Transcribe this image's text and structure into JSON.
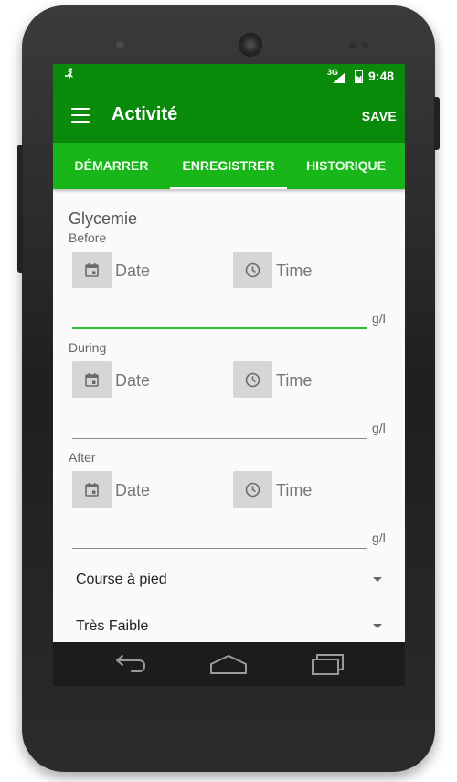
{
  "status_bar": {
    "network": "3G",
    "time": "9:48"
  },
  "app_bar": {
    "title": "Activité",
    "save_label": "SAVE"
  },
  "tabs": [
    {
      "label": "DÉMARRER"
    },
    {
      "label": "ENREGISTRER"
    },
    {
      "label": "HISTORIQUE"
    }
  ],
  "form": {
    "title": "Glycemie",
    "before": {
      "label": "Before",
      "date": "Date",
      "time": "Time",
      "unit": "g/l"
    },
    "during": {
      "label": "During",
      "date": "Date",
      "time": "Time",
      "unit": "g/l"
    },
    "after": {
      "label": "After",
      "date": "Date",
      "time": "Time",
      "unit": "g/l"
    },
    "activity_type": "Course à pied",
    "intensity": "Très Faible"
  },
  "colors": {
    "primary": "#0a8a0a",
    "tabs": "#19b619",
    "accent": "#2ebd2e"
  },
  "icons": [
    "running-icon",
    "signal-icon",
    "battery-icon",
    "menu-icon",
    "calendar-icon",
    "clock-icon",
    "back-icon",
    "home-icon",
    "recents-icon"
  ]
}
